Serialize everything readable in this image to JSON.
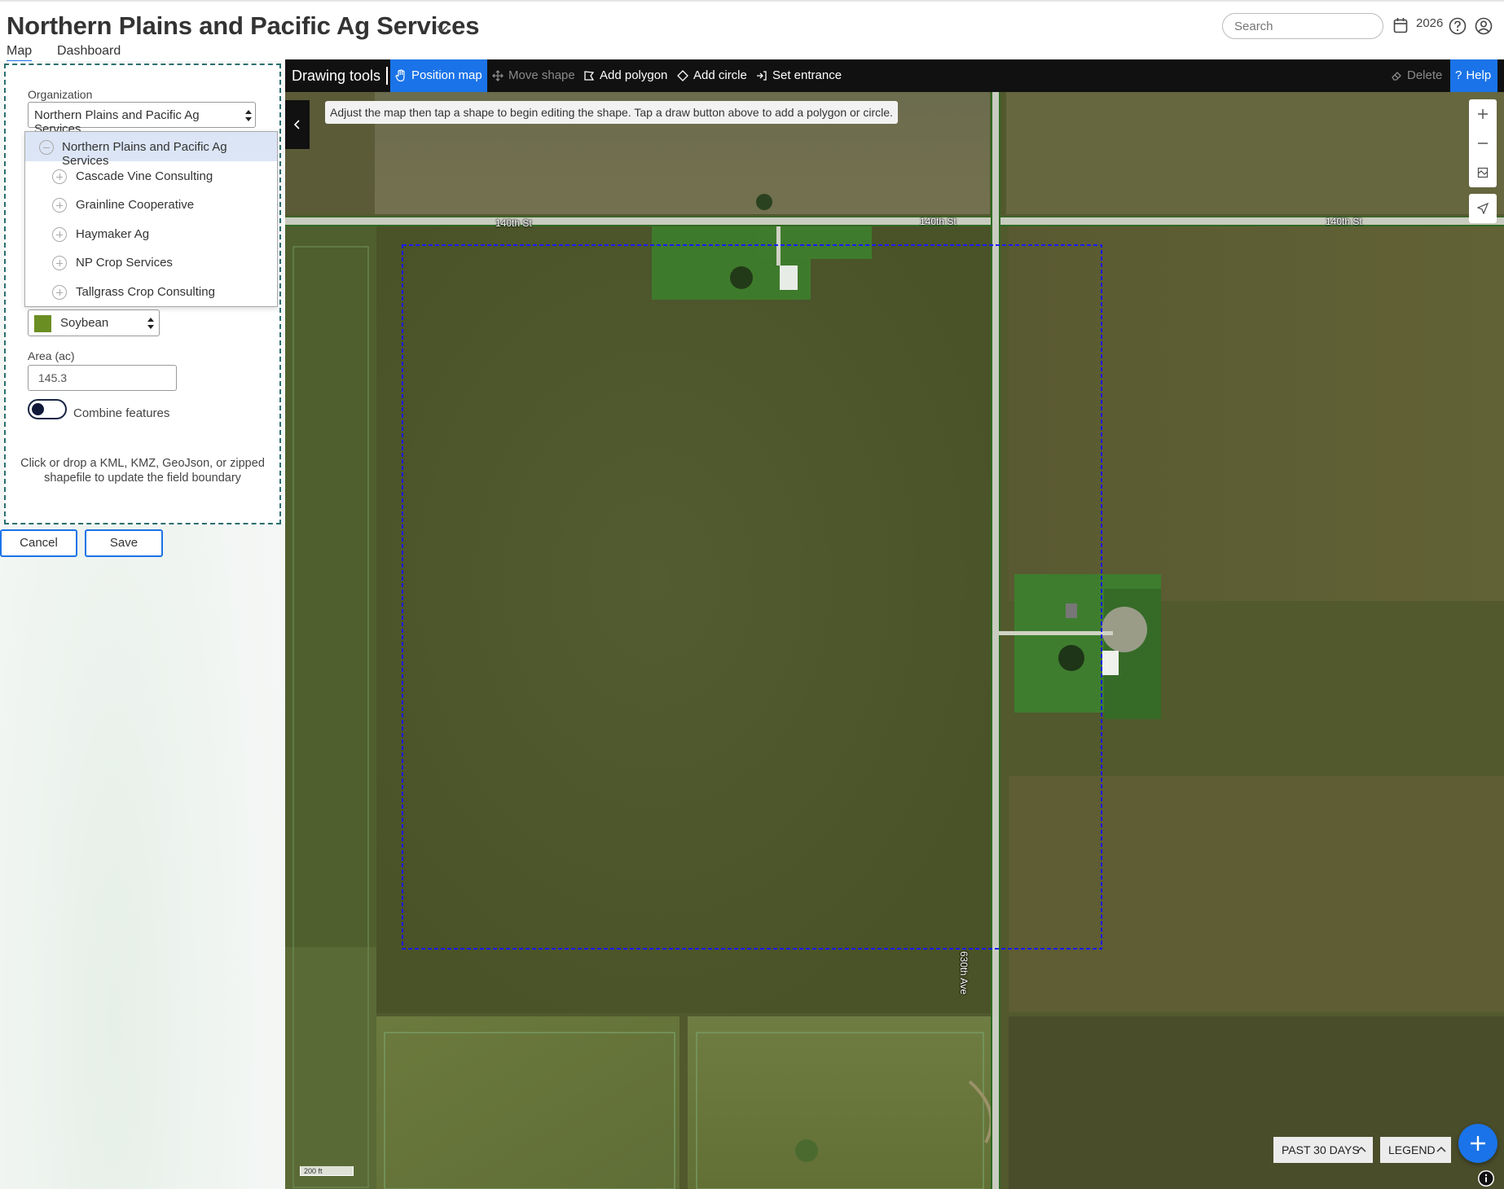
{
  "header": {
    "org_title": "Northern Plains and Pacific Ag Services",
    "tabs": [
      {
        "label": "Map"
      },
      {
        "label": "Dashboard"
      }
    ],
    "search_placeholder": "Search",
    "year": "2026"
  },
  "form": {
    "organization_label": "Organization",
    "organization_value": "Northern Plains and Pacific Ag Services",
    "organization_options": [
      {
        "label": "Northern Plains and Pacific Ag Services",
        "selected": true
      },
      {
        "label": "Cascade Vine Consulting"
      },
      {
        "label": "Grainline Cooperative"
      },
      {
        "label": "Haymaker Ag"
      },
      {
        "label": "NP Crop Services"
      },
      {
        "label": "Tallgrass Crop Consulting"
      }
    ],
    "crop_value": "Soybean",
    "crop_color": "#6b8e23",
    "area_label": "Area (ac)",
    "area_value": "145.3",
    "combine_label": "Combine features",
    "combine_on": true,
    "drop_hint": "Click or drop a KML, KMZ, GeoJson, or zipped shapefile to update the field boundary",
    "cancel_label": "Cancel",
    "save_label": "Save"
  },
  "toolbar": {
    "title": "Drawing tools",
    "position_map": "Position map",
    "move_shape": "Move shape",
    "add_polygon": "Add polygon",
    "add_circle": "Add circle",
    "set_entrance": "Set entrance",
    "delete": "Delete",
    "help": "Help"
  },
  "map": {
    "hint": "Adjust the map then tap a shape to begin editing the shape. Tap a draw button above to add a polygon or circle.",
    "road_labels": [
      "140th St",
      "140th St",
      "140th St",
      "630th Ave"
    ],
    "scale_label": "200 ft",
    "time_filter": "PAST 30 DAYS",
    "legend": "LEGEND",
    "boundary_color": "#1a1aff"
  }
}
